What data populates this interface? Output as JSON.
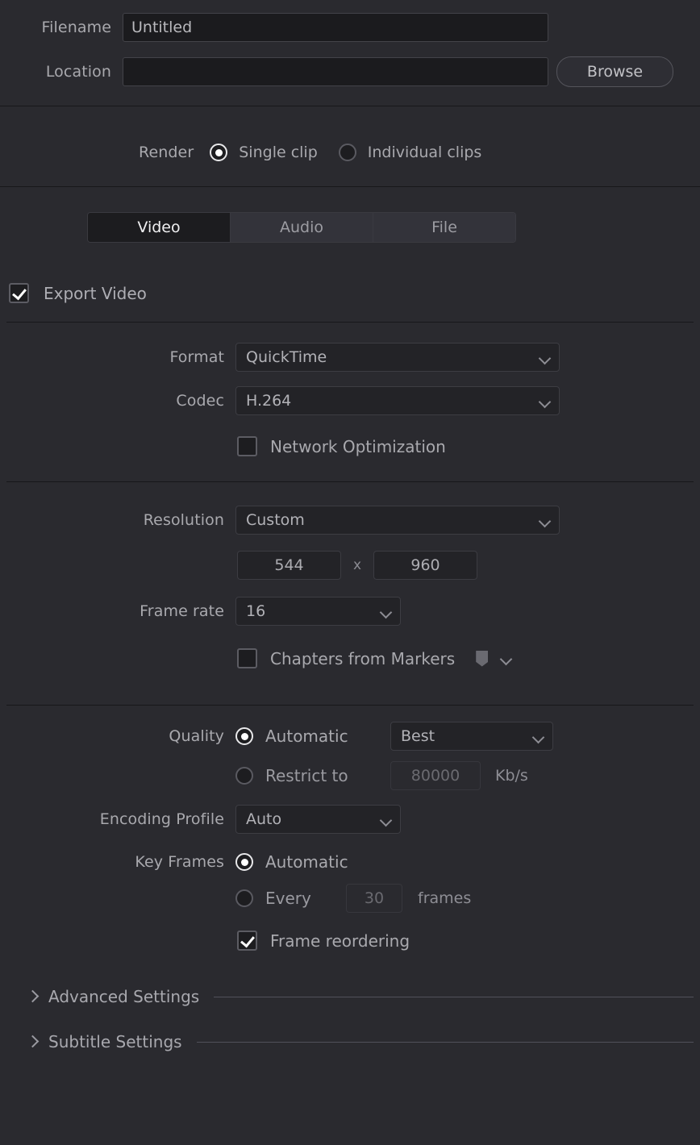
{
  "file_settings": {
    "filename_label": "Filename",
    "filename_value": "Untitled",
    "location_label": "Location",
    "location_value": "",
    "location_placeholder": "",
    "browse_label": "Browse"
  },
  "render_mode": {
    "label": "Render",
    "options": [
      {
        "label": "Single clip",
        "selected": true
      },
      {
        "label": "Individual clips",
        "selected": false
      }
    ]
  },
  "tabs": [
    {
      "label": "Video",
      "active": true
    },
    {
      "label": "Audio",
      "active": false
    },
    {
      "label": "File",
      "active": false
    }
  ],
  "export_video": {
    "label": "Export Video",
    "checked": true
  },
  "format_section": {
    "format_label": "Format",
    "format_value": "QuickTime",
    "codec_label": "Codec",
    "codec_value": "H.264",
    "network_optimization_label": "Network Optimization",
    "network_optimization_checked": false
  },
  "resolution_section": {
    "resolution_label": "Resolution",
    "resolution_value": "Custom",
    "width_value": "544",
    "x_separator": "x",
    "height_value": "960",
    "frame_rate_label": "Frame rate",
    "frame_rate_value": "16",
    "chapters_label": "Chapters from Markers",
    "chapters_checked": false,
    "marker_color_value": ""
  },
  "quality_section": {
    "quality_label": "Quality",
    "automatic_label": "Automatic",
    "automatic_selected": true,
    "quality_preset_value": "Best",
    "restrict_label": "Restrict to",
    "restrict_selected": false,
    "restrict_value": "80000",
    "restrict_unit": "Kb/s",
    "encoding_profile_label": "Encoding Profile",
    "encoding_profile_value": "Auto",
    "key_frames_label": "Key Frames",
    "key_frames_automatic_label": "Automatic",
    "key_frames_automatic_selected": true,
    "key_frames_every_label": "Every",
    "key_frames_every_selected": false,
    "key_frames_every_value": "30",
    "key_frames_unit": "frames",
    "frame_reordering_label": "Frame reordering",
    "frame_reordering_checked": true
  },
  "collapsible_sections": [
    {
      "label": "Advanced Settings",
      "expanded": false
    },
    {
      "label": "Subtitle Settings",
      "expanded": false
    }
  ],
  "colors": {
    "background": "#2a2a2f",
    "field_background": "#1b1b1e",
    "active_tab_background": "#1c1c1f",
    "text_primary": "#b4b4b8",
    "text_active": "#efeff1",
    "divider": "#17171a",
    "marker_grey": "#6a6a71"
  }
}
